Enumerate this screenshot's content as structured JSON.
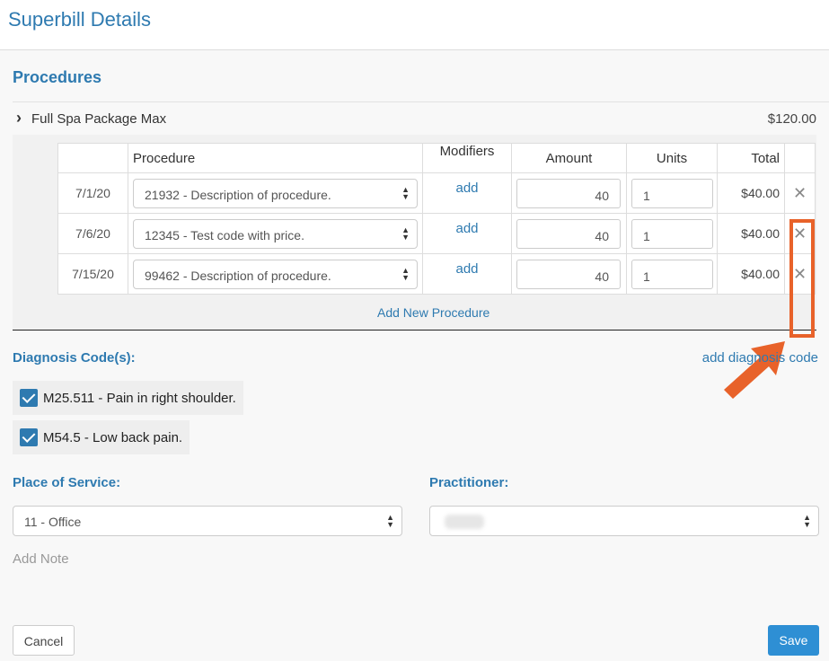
{
  "page": {
    "title": "Superbill Details"
  },
  "procedures": {
    "section_title": "Procedures",
    "package": {
      "name": "Full Spa Package Max",
      "price": "$120.00"
    },
    "columns": [
      "Procedure",
      "Modifiers",
      "Amount",
      "Units",
      "Total"
    ],
    "rows": [
      {
        "date": "7/1/20",
        "procedure": "21932 - Description of procedure.",
        "modifiers": "add",
        "amount": "40",
        "units": "1",
        "total": "$40.00"
      },
      {
        "date": "7/6/20",
        "procedure": "12345 - Test code with price.",
        "modifiers": "add",
        "amount": "40",
        "units": "1",
        "total": "$40.00"
      },
      {
        "date": "7/15/20",
        "procedure": "99462 - Description of procedure.",
        "modifiers": "add",
        "amount": "40",
        "units": "1",
        "total": "$40.00"
      }
    ],
    "add_new_label": "Add New Procedure"
  },
  "diagnosis": {
    "title": "Diagnosis Code(s):",
    "add_label": "add diagnosis code",
    "codes": [
      "M25.511 - Pain in right shoulder.",
      "M54.5 - Low back pain."
    ]
  },
  "place_of_service": {
    "label": "Place of Service:",
    "value": "11 - Office"
  },
  "practitioner": {
    "label": "Practitioner:",
    "value": ""
  },
  "note": {
    "label": "Add Note"
  },
  "buttons": {
    "cancel": "Cancel",
    "save": "Save"
  },
  "colors": {
    "accent": "#2e7ab0",
    "save": "#2e8fd4",
    "highlight": "#e8622a"
  },
  "icons": {
    "remove": "close-icon",
    "expand": "chevron-right-icon",
    "check": "check-icon",
    "select": "select-arrows-icon"
  }
}
